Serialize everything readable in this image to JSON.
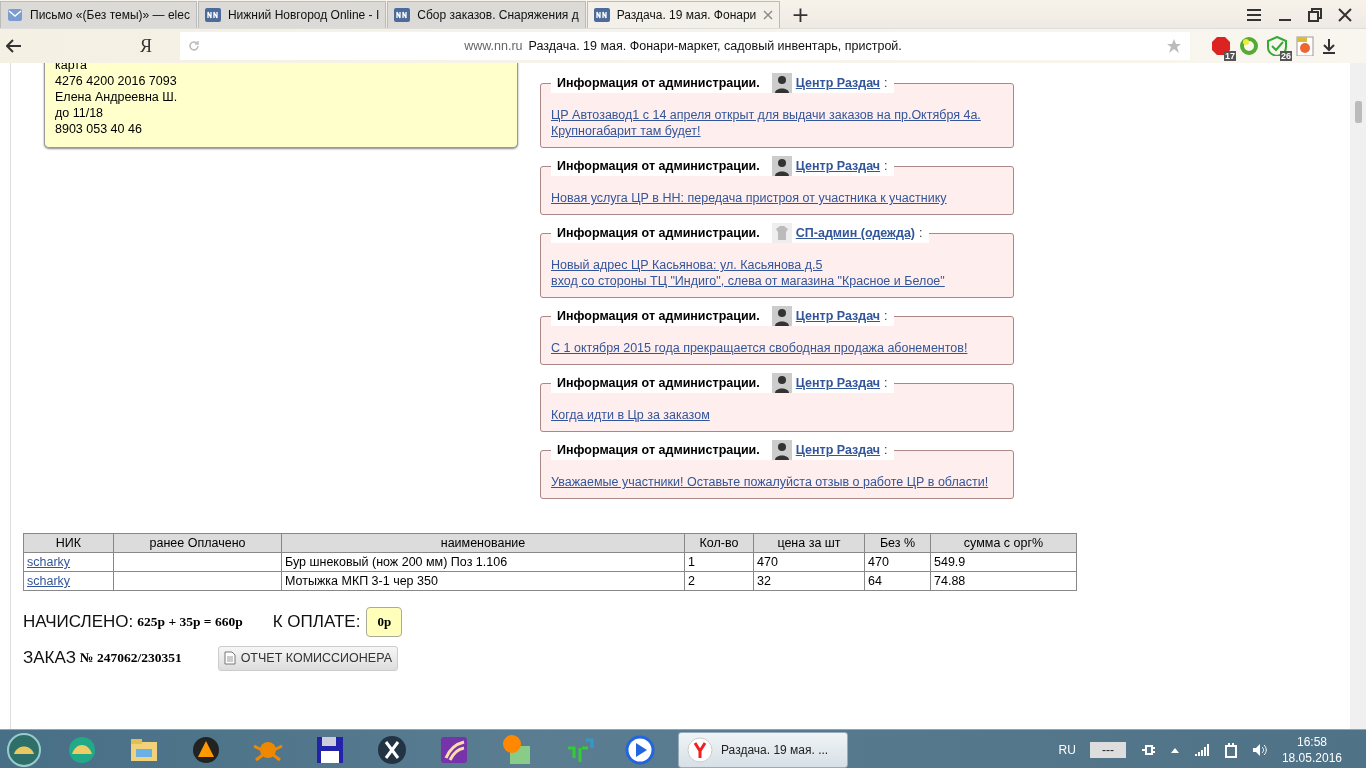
{
  "browser": {
    "tabs": [
      {
        "title": "Письмо «(Без темы)» — elec",
        "selected": false
      },
      {
        "title": "Нижний Новгород Online - I",
        "selected": false
      },
      {
        "title": "Сбор заказов. Снаряжения д",
        "selected": false
      },
      {
        "title": "Раздача. 19 мая. Фонари",
        "selected": true
      }
    ],
    "new_tab": "+",
    "yandex_logo": "Я",
    "address": {
      "domain": "www.nn.ru",
      "title": "Раздача. 19 мая. Фонари-маркет, садовый инвентарь, пристрой."
    },
    "extensions": [
      {
        "kind": "adblock",
        "badge": "17"
      },
      {
        "kind": "ring"
      },
      {
        "kind": "shield",
        "badge": "26"
      },
      {
        "kind": "image"
      }
    ]
  },
  "note": {
    "lines": [
      "карта",
      "4276 4200 2016 7093",
      "Елена Андреевна Ш.",
      "до 11/18",
      "8903 053 40 46"
    ]
  },
  "notices": [
    {
      "kind": "person",
      "heading": "Информация от администрации.",
      "author": "Центр Раздач",
      "separator": ":",
      "lines": [
        "ЦР Автозавод1 с 14 апреля открыт для выдачи заказов на пр.Октября 4а.",
        "Крупногабарит там будет!"
      ]
    },
    {
      "kind": "person",
      "heading": "Информация от администрации.",
      "author": "Центр Раздач",
      "separator": ":",
      "lines": [
        "Новая услуга ЦР в НН: передача пристроя от участника к участнику"
      ]
    },
    {
      "kind": "shirt",
      "heading": "Информация от администрации.",
      "author": "СП-админ (одежда)",
      "separator": ":",
      "lines": [
        "Новый адрес ЦР Касьянова: ул. Касьянова д.5",
        "вход со стороны ТЦ \"Индиго\", слева от магазина \"Красное и Белое\""
      ]
    },
    {
      "kind": "person",
      "heading": "Информация от администрации.",
      "author": "Центр Раздач",
      "separator": ":",
      "lines": [
        "С 1 октября 2015 года прекращается свободная продажа абонементов!"
      ]
    },
    {
      "kind": "person",
      "heading": "Информация от администрации.",
      "author": "Центр Раздач",
      "separator": ":",
      "lines": [
        "Когда идти в Цр за заказом"
      ]
    },
    {
      "kind": "person",
      "heading": "Информация от администрации.",
      "author": "Центр Раздач",
      "separator": ":",
      "lines": [
        "Уважаемые участники! Оставьте пожалуйста отзыв о работе ЦР в области!"
      ]
    }
  ],
  "table": {
    "columns": [
      "НИК",
      "ранее Оплачено",
      "наименование",
      "Кол-во",
      "цена за шт",
      "Без %",
      "сумма с орг%"
    ],
    "rows": [
      [
        "scharky",
        "",
        "Бур шнековый (нож 200 мм) Поз 1.106",
        "1",
        "470",
        "470",
        "549.9"
      ],
      [
        "scharky",
        "",
        "Мотыжка МКП 3-1 чер 350",
        "2",
        "32",
        "64",
        "74.88"
      ]
    ]
  },
  "totals": {
    "charged_label": "НАЧИСЛЕНО:",
    "charged_value": "625р + 35р = 660р",
    "due_label": "К ОПЛАТЕ:",
    "due_value": "0р"
  },
  "order": {
    "label": "ЗАКАЗ",
    "number": "№ 247062/230351",
    "report_button": "ОТЧЕТ КОМИССИОНЕРА"
  },
  "taskbar": {
    "window": {
      "title": "Раздача. 19 мая. ...",
      "selected": true
    },
    "language": "RU",
    "battery": "---",
    "time": "16:58",
    "date": "18.05.2016"
  }
}
